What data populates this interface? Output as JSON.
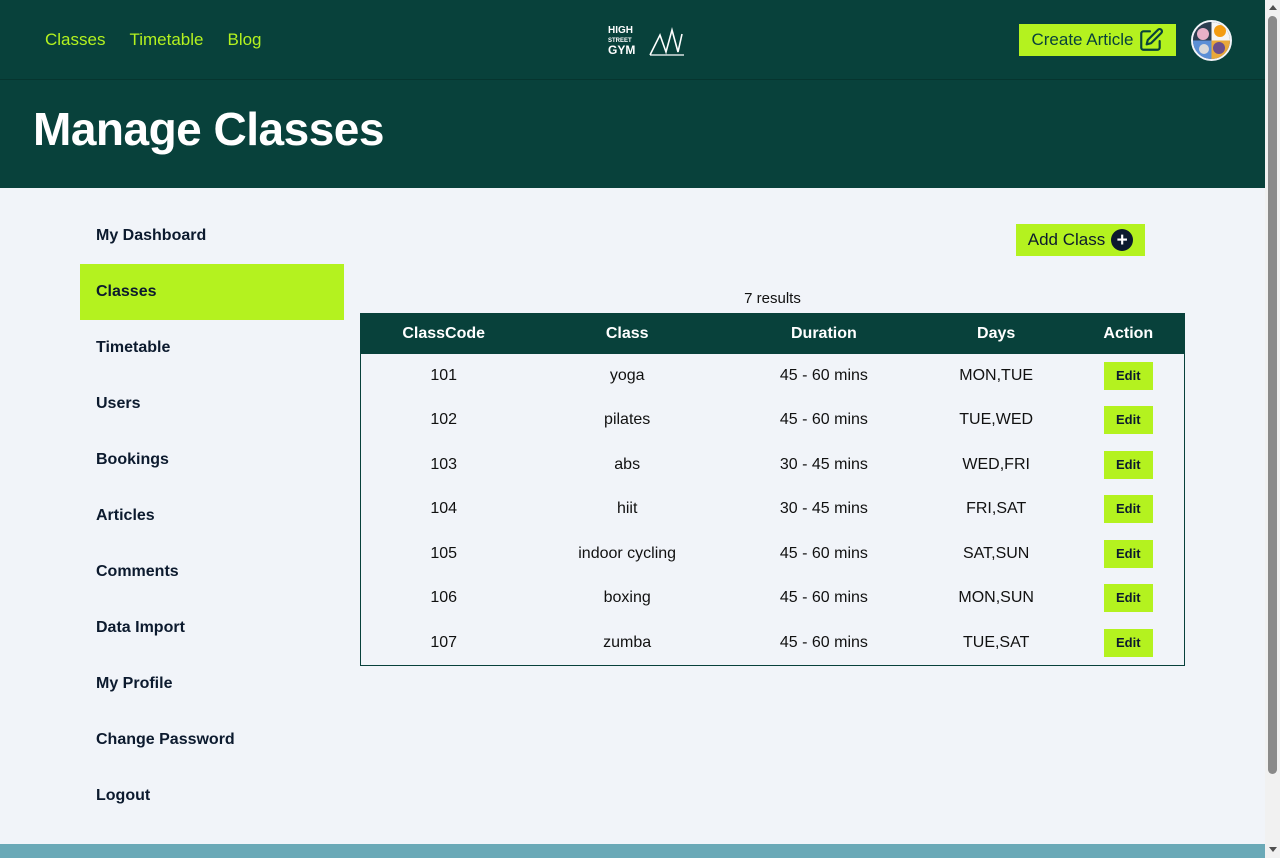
{
  "header": {
    "nav": [
      "Classes",
      "Timetable",
      "Blog"
    ],
    "logo_text": {
      "line1": "HIGH",
      "line2": "STREET",
      "line3": "GYM"
    },
    "create_article_label": "Create Article",
    "accent_color": "#b4f21f",
    "brand_color": "#08413b"
  },
  "page": {
    "title": "Manage Classes"
  },
  "sidebar": {
    "items": [
      {
        "label": "My Dashboard",
        "active": false
      },
      {
        "label": "Classes",
        "active": true
      },
      {
        "label": "Timetable",
        "active": false
      },
      {
        "label": "Users",
        "active": false
      },
      {
        "label": "Bookings",
        "active": false
      },
      {
        "label": "Articles",
        "active": false
      },
      {
        "label": "Comments",
        "active": false
      },
      {
        "label": "Data Import",
        "active": false
      },
      {
        "label": "My Profile",
        "active": false
      },
      {
        "label": "Change Password",
        "active": false
      },
      {
        "label": "Logout",
        "active": false
      }
    ]
  },
  "main": {
    "add_class_label": "Add Class",
    "add_icon": "plus-circle-icon",
    "results_text": "7 results",
    "table": {
      "headers": [
        "ClassCode",
        "Class",
        "Duration",
        "Days",
        "Action"
      ],
      "rows": [
        {
          "code": "101",
          "class": "yoga",
          "duration": "45 - 60 mins",
          "days": "MON,TUE",
          "action": "Edit"
        },
        {
          "code": "102",
          "class": "pilates",
          "duration": "45 - 60 mins",
          "days": "TUE,WED",
          "action": "Edit"
        },
        {
          "code": "103",
          "class": "abs",
          "duration": "30 - 45 mins",
          "days": "WED,FRI",
          "action": "Edit"
        },
        {
          "code": "104",
          "class": "hiit",
          "duration": "30 - 45 mins",
          "days": "FRI,SAT",
          "action": "Edit"
        },
        {
          "code": "105",
          "class": "indoor cycling",
          "duration": "45 - 60 mins",
          "days": "SAT,SUN",
          "action": "Edit"
        },
        {
          "code": "106",
          "class": "boxing",
          "duration": "45 - 60 mins",
          "days": "MON,SUN",
          "action": "Edit"
        },
        {
          "code": "107",
          "class": "zumba",
          "duration": "45 - 60 mins",
          "days": "TUE,SAT",
          "action": "Edit"
        }
      ]
    }
  }
}
